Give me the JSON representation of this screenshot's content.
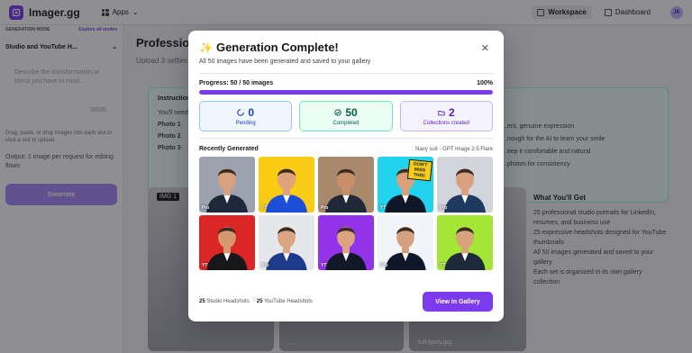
{
  "app": {
    "name": "Imager.gg",
    "apps_label": "Apps"
  },
  "topnav": {
    "workspace": "Workspace",
    "dashboard": "Dashboard",
    "avatar_initials": "JK"
  },
  "sidebar": {
    "mode_label": "GENERATION MODE",
    "explore_label": "Explore all modes",
    "selected_mode": "Studio and YouTube H...",
    "prompt_placeholder": "Describe the transformation or blend you have in mind...",
    "char_count": "0/500",
    "upload_hint": "Drag, paste, or drop images into each slot or click a slot to upload",
    "output_hint": "Output: 1 image per request for editing flows",
    "generate_label": "Generate"
  },
  "main": {
    "title": "Professional Headshots",
    "subtitle": "Upload 3 selfies...",
    "instructions_title": "Instructions",
    "instructions_intro": "You'll need:",
    "photo_lines": [
      "Photo 1",
      "Photo 2",
      "Photo 3"
    ],
    "instruction_right": [
      "...ent, genuine expression",
      "...nough for the AI to learn your smile",
      "...eep it comfortable and natural",
      "...photos for consistency"
    ],
    "photo_captions": [
      "IMG 1",
      "...",
      "full-body.jpg"
    ],
    "know_title": "What You'll Get",
    "know_items": [
      "25 professional studio portraits for LinkedIn, resumes, and business use",
      "25 expressive headshots designed for YouTube thumbnails",
      "All 50 images generated and saved to your gallery",
      "Each set is organized in its own gallery collection"
    ]
  },
  "modal": {
    "title": "Generation Complete!",
    "subtitle": "All 50 images have been generated and saved to your gallery",
    "progress_label": "Progress: 50 / 50 images",
    "progress_percent": "100%",
    "progress_value": 1.0,
    "stats": {
      "pending_value": "0",
      "pending_label": "Pending",
      "completed_value": "50",
      "completed_label": "Completed",
      "collections_value": "2",
      "collections_label": "Collections created"
    },
    "recent_title": "Recently Generated",
    "recent_meta": "Navy suit · GPT Image 2.5 Flare",
    "thumbnails": [
      {
        "badge": "Pro",
        "bg": "#9ca3af",
        "suit": "#1e293b",
        "skin": "#d6a17e"
      },
      {
        "badge": "YT",
        "bg": "#facc15",
        "suit": "#1d4ed8",
        "skin": "#e0a37c"
      },
      {
        "badge": "Pro",
        "bg": "#a8896c",
        "suit": "#1f2937",
        "skin": "#c98f6b"
      },
      {
        "badge": "YT",
        "bg": "#22d3ee",
        "suit": "#0f172a",
        "skin": "#d9a07a",
        "sign": "DON'T MISS THIS!"
      },
      {
        "badge": "Pro",
        "bg": "#d1d5db",
        "suit": "#1e3a5f",
        "skin": "#d8a07e"
      },
      {
        "badge": "YT",
        "bg": "#dc2626",
        "suit": "#18181b",
        "skin": "#d6996f"
      },
      {
        "badge": "Pro",
        "bg": "#e5e7eb",
        "suit": "#1e3a8a",
        "skin": "#d9a582"
      },
      {
        "badge": "YT",
        "bg": "#9333ea",
        "suit": "#111827",
        "skin": "#dba37f"
      },
      {
        "badge": "Pro",
        "bg": "#f1f5f9",
        "suit": "#0f172a",
        "skin": "#d5a080"
      },
      {
        "badge": "YT",
        "bg": "#a3e635",
        "suit": "#1e293b",
        "skin": "#d7a27c"
      }
    ],
    "footer": {
      "studio_count": "25",
      "studio_label": "Studio Headshots",
      "youtube_count": "25",
      "youtube_label": "YouTube Headshots",
      "view_button": "View in Gallery"
    },
    "accent": "#7c3aed"
  }
}
